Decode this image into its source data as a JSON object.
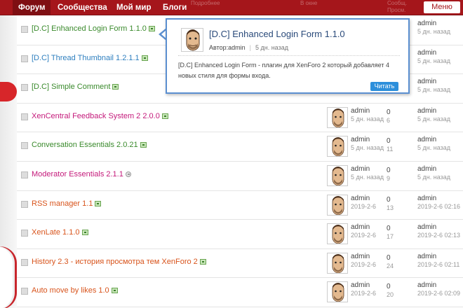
{
  "nav": {
    "items": [
      {
        "label": "Форум",
        "active": true
      },
      {
        "label": "Сообщества",
        "active": false
      },
      {
        "label": "Мой мир",
        "active": false
      },
      {
        "label": "Блоги",
        "active": false
      }
    ],
    "menu_label": "Меню",
    "faint_labels": [
      "Подробнее",
      "В окне",
      "Сообщ.",
      "Просм."
    ]
  },
  "popup": {
    "title": "[D.C] Enhanced Login Form 1.1.0",
    "author": "Автор:admin",
    "date": "5 дн. назад",
    "description": "[D.C] Enhanced Login Form - плагин для XenForo 2 который добавляет 4 новых стиля для формы входа.",
    "read_button": "Читать"
  },
  "colors": {
    "nav_bg": "#a5161b",
    "green_title": "#3a8a2c",
    "blue_title": "#2e7fbf",
    "pink_title": "#c4197a",
    "orange_title": "#d8541c",
    "popup_border": "#5b8fd0",
    "button_blue": "#2d8fdb"
  },
  "threads": [
    {
      "title": "[D.C] Enhanced Login Form 1.1.0",
      "color": "#3a8a2c",
      "lang": "green",
      "user": "",
      "date": "",
      "replies": "",
      "views": "",
      "last_user": "admin",
      "last_date": "5 дн. назад"
    },
    {
      "title": "[D.C] Thread Thumbnail 1.2.1.1",
      "color": "#2e7fbf",
      "lang": "green",
      "user": "",
      "date": "",
      "replies": "",
      "views": "",
      "last_user": "admin",
      "last_date": "5 дн. назад"
    },
    {
      "title": "[D.C] Simple Comment",
      "color": "#3a8a2c",
      "lang": "green",
      "user": "",
      "date": "",
      "replies": "",
      "views": "",
      "last_user": "admin",
      "last_date": "5 дн. назад"
    },
    {
      "title": "XenCentral Feedback System 2 2.0.0",
      "color": "#c4197a",
      "lang": "green",
      "user": "admin",
      "date": "5 дн. назад",
      "replies": "0",
      "views": "6",
      "last_user": "admin",
      "last_date": "5 дн. назад"
    },
    {
      "title": "Conversation Essentials 2.0.21",
      "color": "#3a8a2c",
      "lang": "green",
      "user": "admin",
      "date": "5 дн. назад",
      "replies": "0",
      "views": "11",
      "last_user": "admin",
      "last_date": "5 дн. назад"
    },
    {
      "title": "Moderator Essentials 2.1.1",
      "color": "#c4197a",
      "lang": "ru",
      "user": "admin",
      "date": "5 дн. назад",
      "replies": "0",
      "views": "9",
      "last_user": "admin",
      "last_date": "5 дн. назад"
    },
    {
      "title": "RSS manager 1.1",
      "color": "#d8541c",
      "lang": "green",
      "user": "admin",
      "date": "2019-2-6",
      "replies": "0",
      "views": "13",
      "last_user": "admin",
      "last_date": "2019-2-6 02:16"
    },
    {
      "title": "XenLate 1.1.0",
      "color": "#d8541c",
      "lang": "green",
      "user": "admin",
      "date": "2019-2-6",
      "replies": "0",
      "views": "17",
      "last_user": "admin",
      "last_date": "2019-2-6 02:13"
    },
    {
      "title": "History 2.3 - история просмотра тем XenForo 2",
      "color": "#d8541c",
      "lang": "green",
      "user": "admin",
      "date": "2019-2-6",
      "replies": "0",
      "views": "24",
      "last_user": "admin",
      "last_date": "2019-2-6 02:11"
    },
    {
      "title": "Auto move by likes 1.0",
      "color": "#d8541c",
      "lang": "green",
      "user": "admin",
      "date": "2019-2-6",
      "replies": "0",
      "views": "20",
      "last_user": "admin",
      "last_date": "2019-2-6 02:09"
    }
  ]
}
